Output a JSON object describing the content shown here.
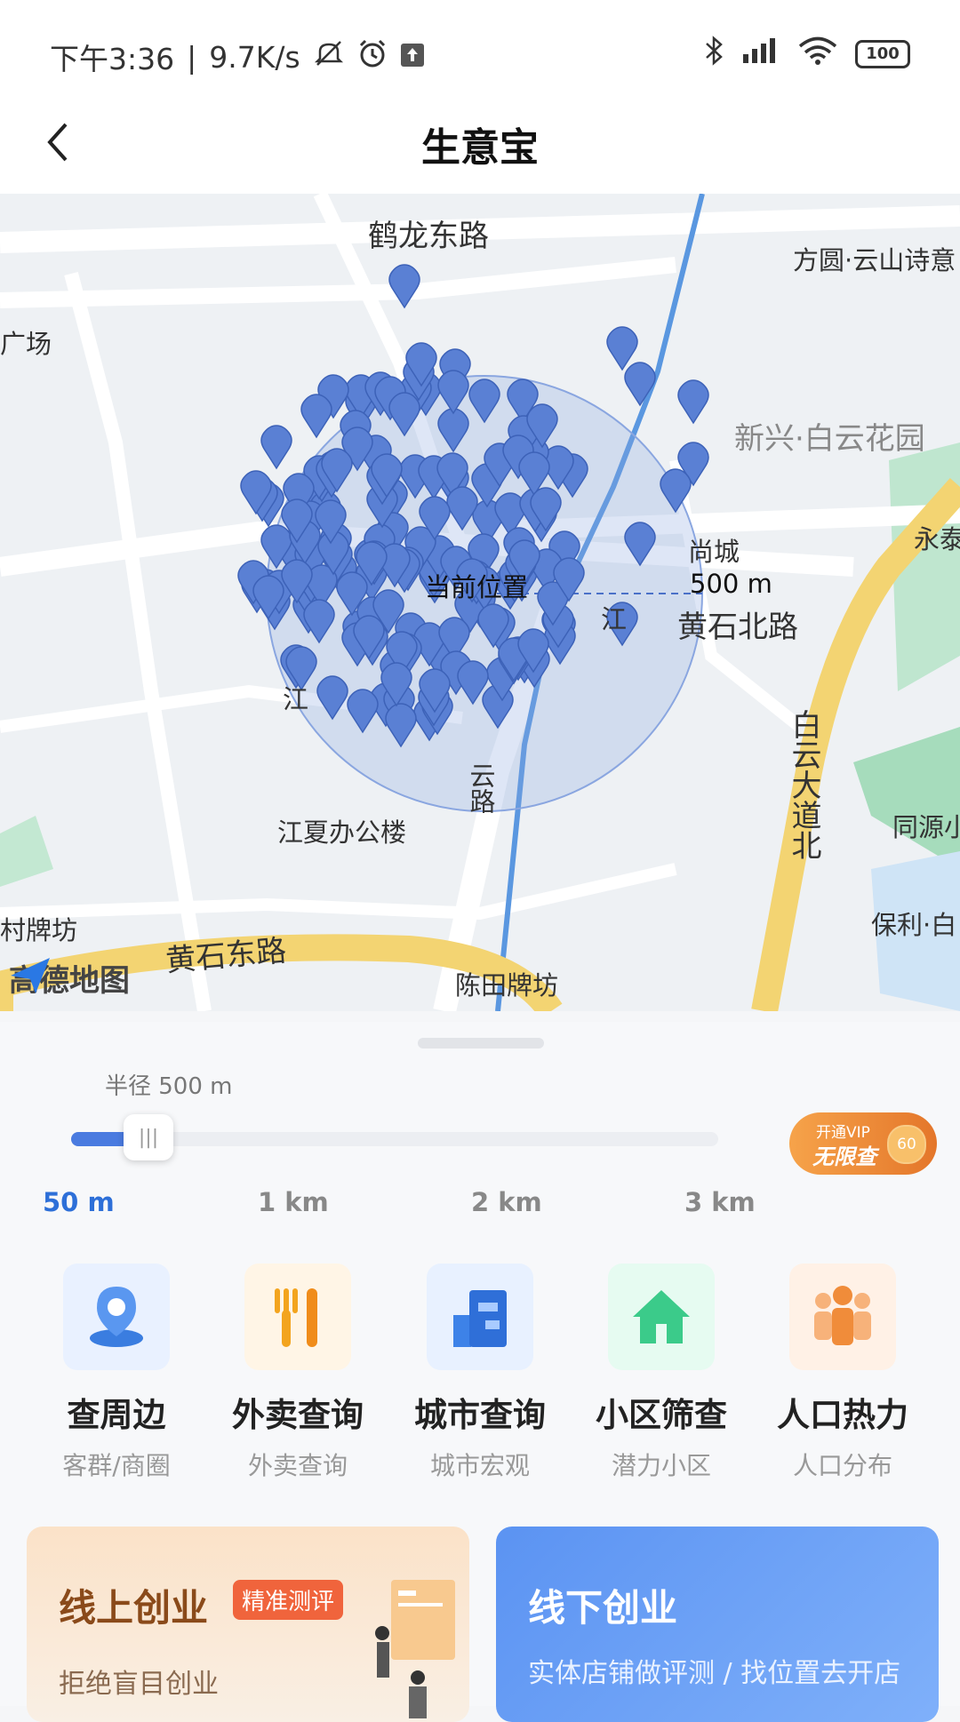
{
  "status_bar": {
    "time": "下午3:36",
    "speed": "9.7K/s",
    "battery": "100"
  },
  "header": {
    "title": "生意宝"
  },
  "map": {
    "labels": {
      "helong_road": "鹤龙东路",
      "fangyuan": "方圆·云山诗意",
      "guangchang": "广场",
      "xinxing": "新兴·白云花园",
      "yongtai": "永泰",
      "current": "当前位置",
      "shangcheng": "尚城",
      "radius_marker": "500 m",
      "huangshi_north": "黄石北路",
      "jiangxia_office": "江夏办公楼",
      "baiyun_avenue": "白云大道北",
      "tongyuan": "同源小",
      "cunpaifang": "村牌坊",
      "huangshi_east": "黄石东路",
      "baoli": "保利·白",
      "chentian": "陈田牌坊",
      "gaode": "高德地图",
      "jiang": "江",
      "jiang2": "江",
      "yunlu": "云路"
    },
    "circle_colour": "#8aa6e0",
    "pin_colour": "#5a80d4"
  },
  "panel": {
    "radius_label": "半径 500 m",
    "slider_value_km": 0.05,
    "slider_max_km": 3,
    "ticks": [
      "50 m",
      "1 km",
      "2 km",
      "3 km"
    ],
    "vip": {
      "line1": "开通VIP",
      "line2": "无限查",
      "coin": "60"
    },
    "features": [
      {
        "name": "查周边",
        "desc": "客群/商圈",
        "icon": "location-pin-icon"
      },
      {
        "name": "外卖查询",
        "desc": "外卖查询",
        "icon": "fork-knife-icon"
      },
      {
        "name": "城市查询",
        "desc": "城市宏观",
        "icon": "city-building-icon"
      },
      {
        "name": "小区筛查",
        "desc": "潜力小区",
        "icon": "house-icon"
      },
      {
        "name": "人口热力",
        "desc": "人口分布",
        "icon": "people-icon"
      }
    ],
    "cards": {
      "online": {
        "title": "线上创业",
        "tag": "精准测评",
        "sub": "拒绝盲目创业"
      },
      "offline": {
        "title": "线下创业",
        "sub": "实体店铺做评测 / 找位置去开店"
      }
    }
  }
}
